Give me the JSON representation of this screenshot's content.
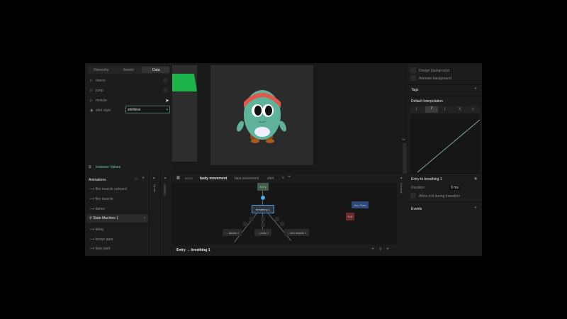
{
  "left_panel": {
    "tabs": [
      "Hierarchy",
      "Assets",
      "Data"
    ],
    "active_tab": "Data",
    "inputs": [
      {
        "label": "dance"
      },
      {
        "label": "jump"
      },
      {
        "label": "muscle"
      },
      {
        "label": "shirt style",
        "value": "shirtless"
      }
    ],
    "instance_values": "Instance Values"
  },
  "animations": {
    "title": "Animations",
    "items": [
      "flex muscle outward",
      "flex muscle",
      "dance",
      "State Machine 1",
      "delay",
      "brown pant",
      "blue pant"
    ],
    "selected": "State Machine 1"
  },
  "side_tabs": {
    "inputs": "Inputs",
    "listeners": "Listeners",
    "console": "Console"
  },
  "state_machine": {
    "layers": [
      "BOTE",
      "body movement",
      "face movement",
      "shirt"
    ],
    "active_layer": "body movement",
    "nodes": {
      "entry": "Entry",
      "breathing": "breathing 1",
      "dance": "→ dance 1",
      "jump": "→ jump 1",
      "flex": "→ flex muscle 1",
      "any_state": "Any State",
      "exit": "Exit"
    },
    "footer": "Entry → breathing 1"
  },
  "canvas": {
    "zoom_label": "Ss"
  },
  "right_panel": {
    "design_background": "Design background",
    "animate_background": "Animate background",
    "tags": "Tags",
    "default_interpolation": "Default Interpolation",
    "transition_title": "Entry to breathing 1",
    "duration_label": "Duration",
    "duration_value": "0 ms",
    "allow_exit": "Allow exit during transition",
    "events": "Events"
  },
  "colors": {
    "accent_green": "#1bb34a",
    "entry": "#3d5e48",
    "any_state": "#2d4a78",
    "exit": "#6a2a2e",
    "selected": "#5aa0e0"
  }
}
